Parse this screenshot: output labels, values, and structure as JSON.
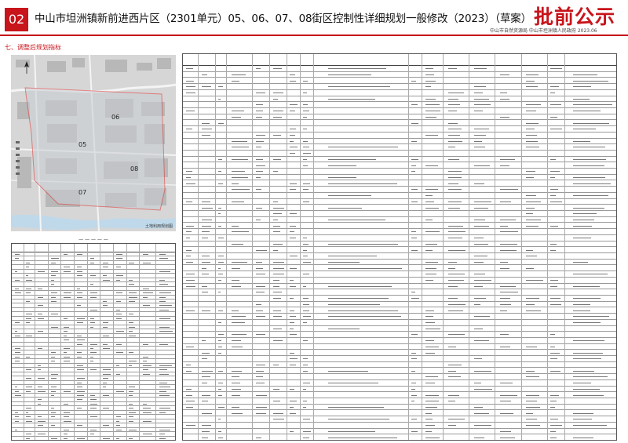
{
  "header": {
    "page_number": "02",
    "title": "中山市坦洲镇新前进西片区（2301单元）05、06、07、08街区控制性详细规划一般修改（2023）（草案）",
    "stamp": "批前公示",
    "subtitle": "中山市自然资源局 中山市坦洲镇人民政府 2023.06"
  },
  "section": {
    "title": "七、调整后规划指标"
  },
  "map": {
    "block_labels": [
      "06",
      "05",
      "08",
      "07"
    ],
    "caption": "土地利用规划图"
  },
  "colors": {
    "accent": "#c8141b",
    "map_bg": "#dcdcdc",
    "boundary": "#e03030"
  }
}
